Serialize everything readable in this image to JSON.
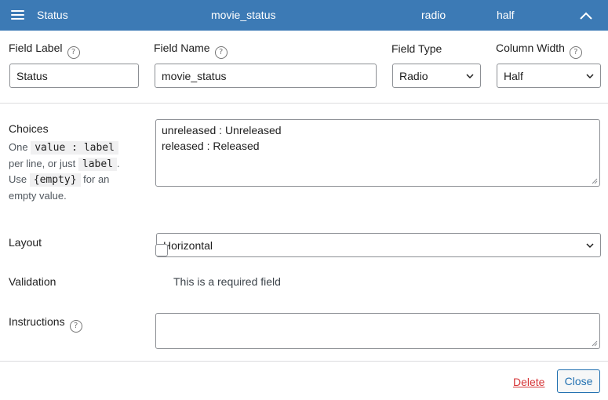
{
  "header": {
    "field_label": "Status",
    "field_name": "movie_status",
    "field_type": "radio",
    "column_width": "half"
  },
  "row1": {
    "field_label": {
      "label": "Field Label",
      "value": "Status"
    },
    "field_name": {
      "label": "Field Name",
      "value": "movie_status"
    },
    "field_type": {
      "label": "Field Type",
      "value": "Radio"
    },
    "column_width": {
      "label": "Column Width",
      "value": "Half"
    }
  },
  "choices": {
    "label": "Choices",
    "desc": {
      "t1": "One",
      "c1": "value : label",
      "t2": "per line, or just",
      "c2": "label",
      "t3": ".",
      "t4": "Use",
      "c3": "{empty}",
      "t5": "for an",
      "t6": "empty value."
    },
    "lines": [
      "unreleased : Unreleased",
      "released : Released"
    ]
  },
  "layout": {
    "label": "Layout",
    "value": "Horizontal"
  },
  "validation": {
    "label": "Validation",
    "checkbox_label": "This is a required field",
    "checked": false
  },
  "instructions": {
    "label": "Instructions",
    "value": ""
  },
  "footer": {
    "delete": "Delete",
    "close": "Close"
  },
  "help_symbol": "?",
  "colors": {
    "header_bg": "#3c7ab5",
    "danger": "#d63638",
    "primary": "#2271b1",
    "border": "#8c8f94"
  },
  "icons": {
    "menu": "hamburger-menu-icon",
    "collapse": "chevron-up-icon",
    "help": "question-circle-icon",
    "dropdown": "chevron-down-icon"
  }
}
